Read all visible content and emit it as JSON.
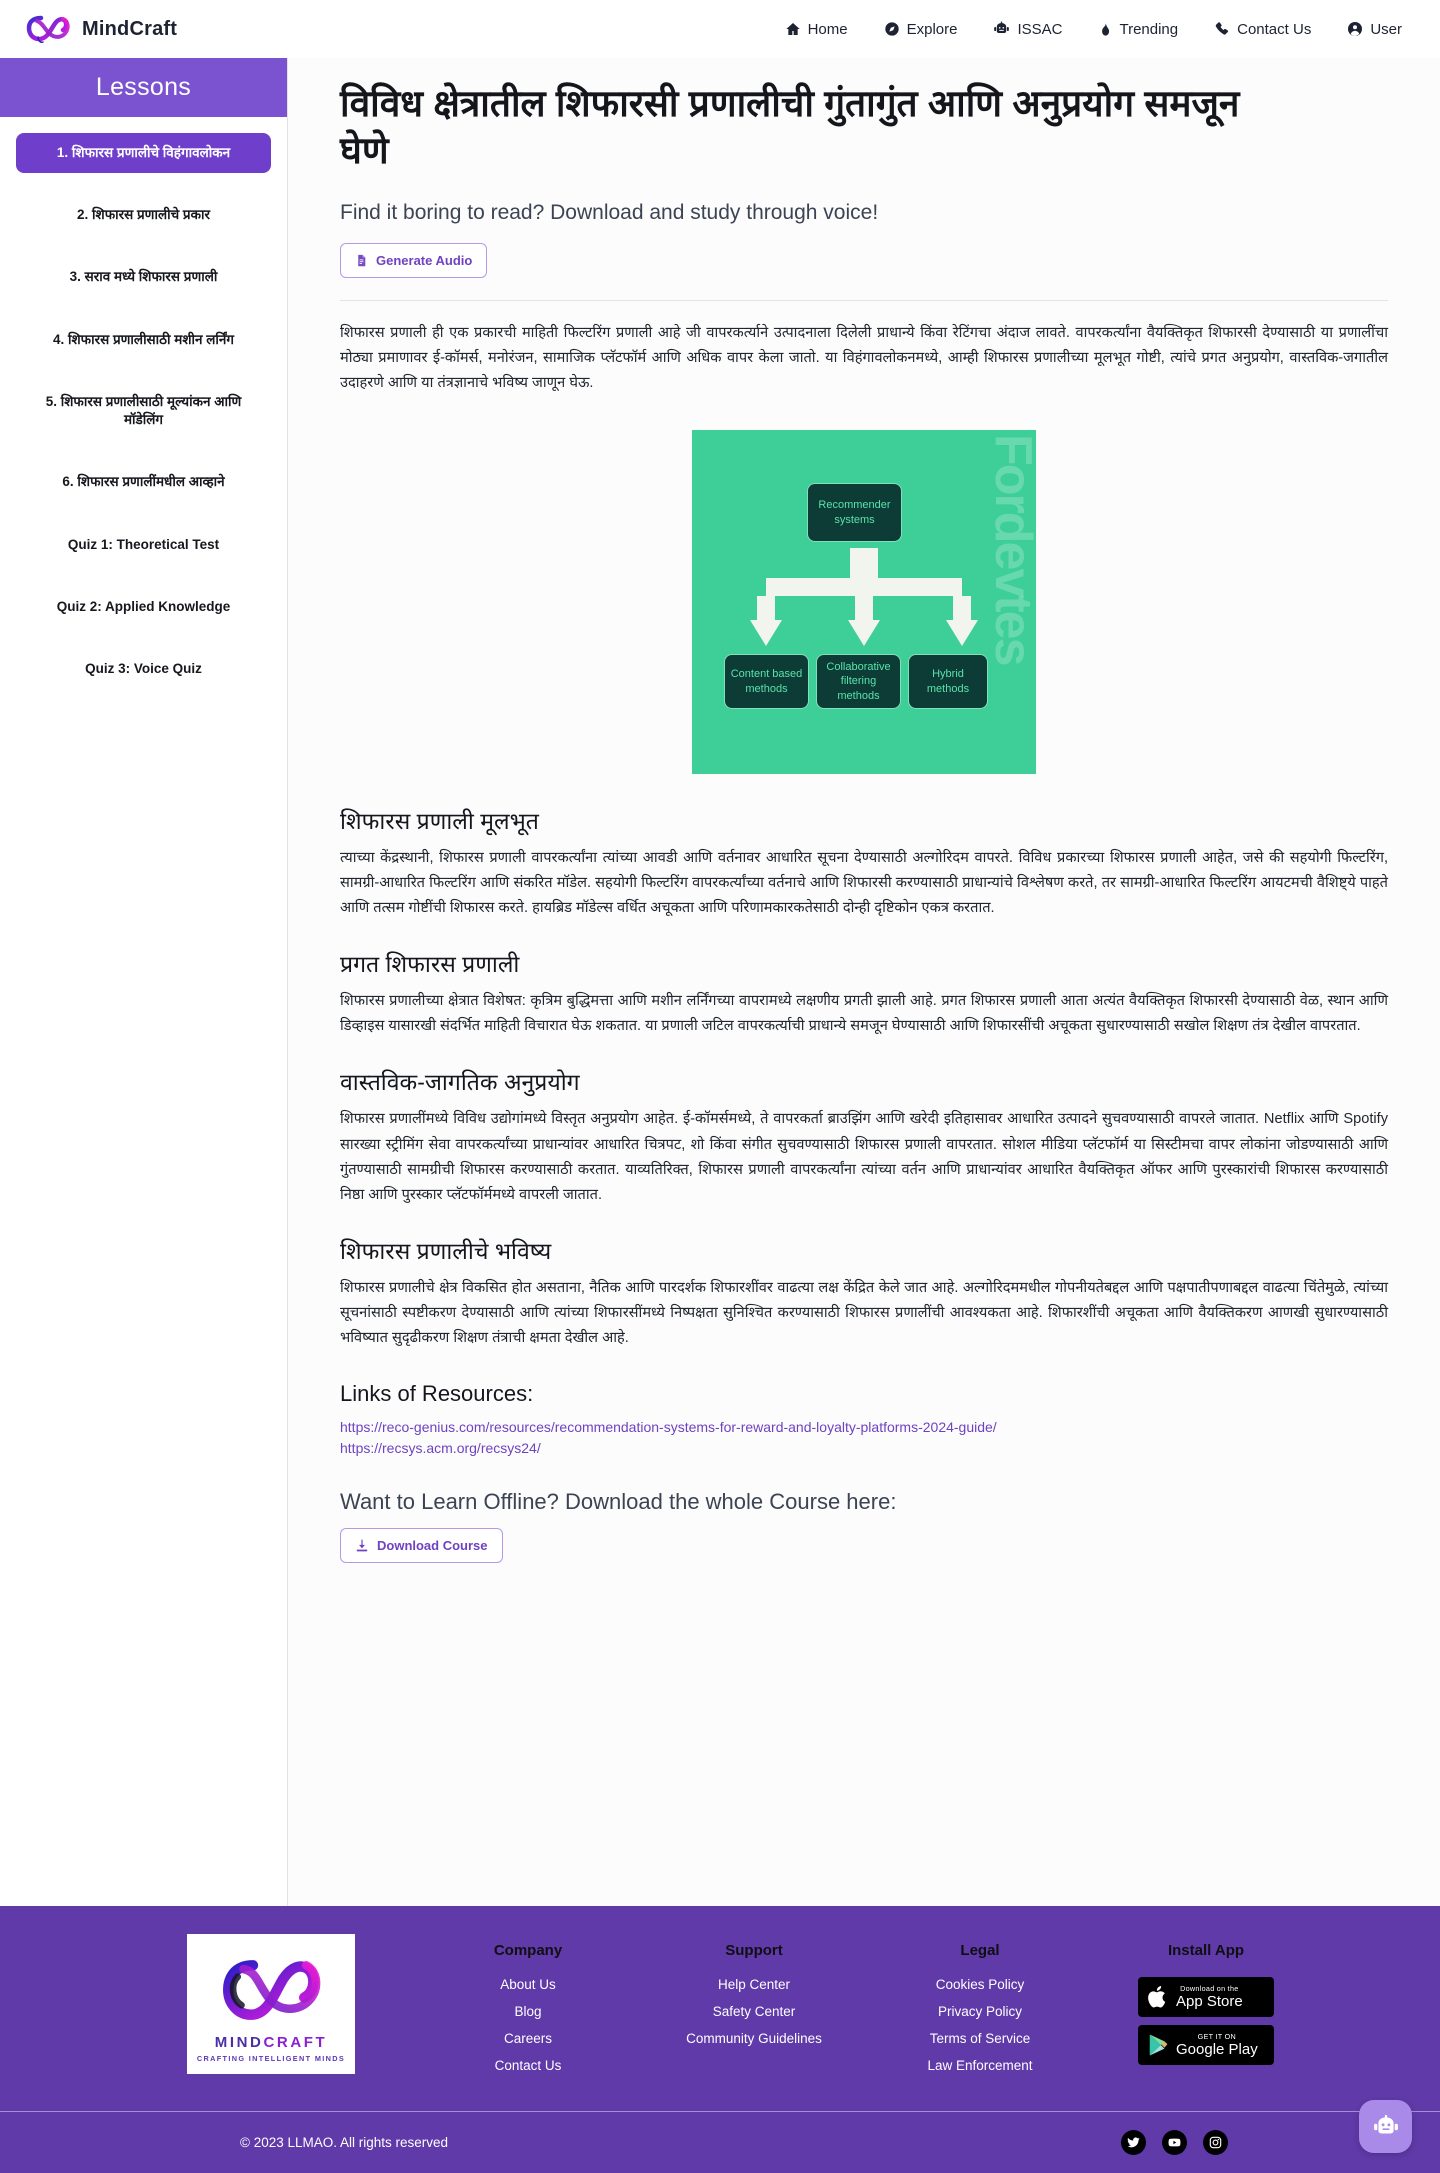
{
  "navbar": {
    "brand": "MindCraft",
    "links": [
      {
        "label": "Home",
        "icon": "home-icon"
      },
      {
        "label": "Explore",
        "icon": "compass-icon"
      },
      {
        "label": "ISSAC",
        "icon": "robot-icon"
      },
      {
        "label": "Trending",
        "icon": "fire-icon"
      },
      {
        "label": "Contact Us",
        "icon": "phone-icon"
      },
      {
        "label": "User",
        "icon": "user-icon"
      }
    ]
  },
  "sidebar": {
    "title": "Lessons",
    "items": [
      {
        "label": "1. शिफारस प्रणालीचे विहंगावलोकन",
        "active": true
      },
      {
        "label": "2. शिफारस प्रणालीचे प्रकार",
        "active": false
      },
      {
        "label": "3. सराव मध्ये शिफारस प्रणाली",
        "active": false
      },
      {
        "label": "4. शिफारस प्रणालीसाठी मशीन लर्निंग",
        "active": false
      },
      {
        "label": "5. शिफारस प्रणालीसाठी मूल्यांकन आणि मॉडेलिंग",
        "active": false
      },
      {
        "label": "6. शिफारस प्रणालींमधील आव्हाने",
        "active": false
      },
      {
        "label": "Quiz 1: Theoretical Test",
        "active": false
      },
      {
        "label": "Quiz 2: Applied Knowledge",
        "active": false
      },
      {
        "label": "Quiz 3: Voice Quiz",
        "active": false
      }
    ]
  },
  "main": {
    "title": "विविध क्षेत्रातील शिफारसी प्रणालीची गुंतागुंत आणि अनुप्रयोग समजून घेणे",
    "subtitle": "Find it boring to read? Download and study through voice!",
    "generate_audio_label": "Generate Audio",
    "intro": "शिफारस प्रणाली ही एक प्रकारची माहिती फिल्टरिंग प्रणाली आहे जी वापरकर्त्याने उत्पादनाला दिलेली प्राधान्ये किंवा रेटिंगचा अंदाज लावते. वापरकर्त्यांना वैयक्तिकृत शिफारसी देण्यासाठी या प्रणालींचा मोठ्या प्रमाणावर ई-कॉमर्स, मनोरंजन, सामाजिक प्लॅटफॉर्म आणि अधिक वापर केला जातो. या विहंगावलोकनमध्ये, आम्ही शिफारस प्रणालीच्या मूलभूत गोष्टी, त्यांचे प्रगत अनुप्रयोग, वास्तविक-जगातील उदाहरणे आणि या तंत्रज्ञानाचे भविष्य जाणून घेऊ.",
    "figure": {
      "alt": "recommender-systems-diagram",
      "watermark": "Fordevtes",
      "root": "Recommender systems",
      "children": [
        "Content based methods",
        "Collaborative filtering methods",
        "Hybrid methods"
      ]
    },
    "sections": [
      {
        "heading": "शिफारस प्रणाली मूलभूत",
        "text": "त्याच्या केंद्रस्थानी, शिफारस प्रणाली वापरकर्त्यांना त्यांच्या आवडी आणि वर्तनावर आधारित सूचना देण्यासाठी अल्गोरिदम वापरते. विविध प्रकारच्या शिफारस प्रणाली आहेत, जसे की सहयोगी फिल्टरिंग, सामग्री-आधारित फिल्टरिंग आणि संकरित मॉडेल. सहयोगी फिल्टरिंग वापरकर्त्यांच्या वर्तनाचे आणि शिफारसी करण्यासाठी प्राधान्यांचे विश्लेषण करते, तर सामग्री-आधारित फिल्टरिंग आयटमची वैशिष्ट्ये पाहते आणि तत्सम गोष्टींची शिफारस करते. हायब्रिड मॉडेल्स वर्धित अचूकता आणि परिणामकारकतेसाठी दोन्ही दृष्टिकोन एकत्र करतात."
      },
      {
        "heading": "प्रगत शिफारस प्रणाली",
        "text": "शिफारस प्रणालीच्या क्षेत्रात विशेषत: कृत्रिम बुद्धिमत्ता आणि मशीन लर्निंगच्या वापरामध्ये लक्षणीय प्रगती झाली आहे. प्रगत शिफारस प्रणाली आता अत्यंत वैयक्तिकृत शिफारसी देण्यासाठी वेळ, स्थान आणि डिव्हाइस यासारखी संदर्भित माहिती विचारात घेऊ शकतात. या प्रणाली जटिल वापरकर्त्याची प्राधान्ये समजून घेण्यासाठी आणि शिफारसींची अचूकता सुधारण्यासाठी सखोल शिक्षण तंत्र देखील वापरतात."
      },
      {
        "heading": "वास्तविक-जागतिक अनुप्रयोग",
        "text": "शिफारस प्रणालींमध्ये विविध उद्योगांमध्ये विस्तृत अनुप्रयोग आहेत. ई-कॉमर्समध्ये, ते वापरकर्ता ब्राउझिंग आणि खरेदी इतिहासावर आधारित उत्पादने सुचवण्यासाठी वापरले जातात. Netflix आणि Spotify सारख्या स्ट्रीमिंग सेवा वापरकर्त्यांच्या प्राधान्यांवर आधारित चित्रपट, शो किंवा संगीत सुचवण्यासाठी शिफारस प्रणाली वापरतात. सोशल मीडिया प्लॅटफॉर्म या सिस्टीमचा वापर लोकांना जोडण्यासाठी आणि गुंतण्यासाठी सामग्रीची शिफारस करण्यासाठी करतात. याव्यतिरिक्त, शिफारस प्रणाली वापरकर्त्यांना त्यांच्या वर्तन आणि प्राधान्यांवर आधारित वैयक्तिकृत ऑफर आणि पुरस्कारांची शिफारस करण्यासाठी निष्ठा आणि पुरस्कार प्लॅटफॉर्ममध्ये वापरली जातात."
      },
      {
        "heading": "शिफारस प्रणालीचे भविष्य",
        "text": "शिफारस प्रणालीचे क्षेत्र विकसित होत असताना, नैतिक आणि पारदर्शक शिफारशींवर वाढत्या लक्ष केंद्रित केले जात आहे. अल्गोरिदममधील गोपनीयतेबद्दल आणि पक्षपातीपणाबद्दल वाढत्या चिंतेमुळे, त्यांच्या सूचनांसाठी स्पष्टीकरण देण्यासाठी आणि त्यांच्या शिफारसींमध्ये निष्पक्षता सुनिश्चित करण्यासाठी शिफारस प्रणालींची आवश्यकता आहे. शिफारशींची अचूकता आणि वैयक्तिकरण आणखी सुधारण्यासाठी भविष्यात सुदृढीकरण शिक्षण तंत्राची क्षमता देखील आहे."
      }
    ],
    "links_heading": "Links of Resources:",
    "resource_links": [
      "https://reco-genius.com/resources/recommendation-systems-for-reward-and-loyalty-platforms-2024-guide/",
      "https://recsys.acm.org/recsys24/"
    ],
    "offline_heading": "Want to Learn Offline? Download the whole Course here:",
    "download_label": "Download Course"
  },
  "footer": {
    "logo": {
      "word_1": "MIND",
      "word_2": "CRAFT",
      "tagline": "CRAFTING INTELLIGENT MINDS"
    },
    "columns": [
      {
        "title": "Company",
        "links": [
          "About Us",
          "Blog",
          "Careers",
          "Contact Us"
        ]
      },
      {
        "title": "Support",
        "links": [
          "Help Center",
          "Safety Center",
          "Community Guidelines"
        ]
      },
      {
        "title": "Legal",
        "links": [
          "Cookies Policy",
          "Privacy Policy",
          "Terms of Service",
          "Law Enforcement"
        ]
      }
    ],
    "install": {
      "title": "Install App",
      "appstore_small": "Download on the",
      "appstore_big": "App Store",
      "play_small": "GET IT ON",
      "play_big": "Google Play"
    },
    "copyright": "© 2023 LLMAO. All rights reserved",
    "socials": [
      "twitter-icon",
      "youtube-icon",
      "instagram-icon"
    ],
    "chatbot": "robot-icon"
  },
  "colors": {
    "brand_purple": "#6f42c1",
    "sidebar_header": "#7b52cf",
    "sidebar_active": "#6f3fcc",
    "footer_bg": "#5f3aa8",
    "figure_green": "#3ecf98",
    "figure_node": "#0d3b35"
  }
}
